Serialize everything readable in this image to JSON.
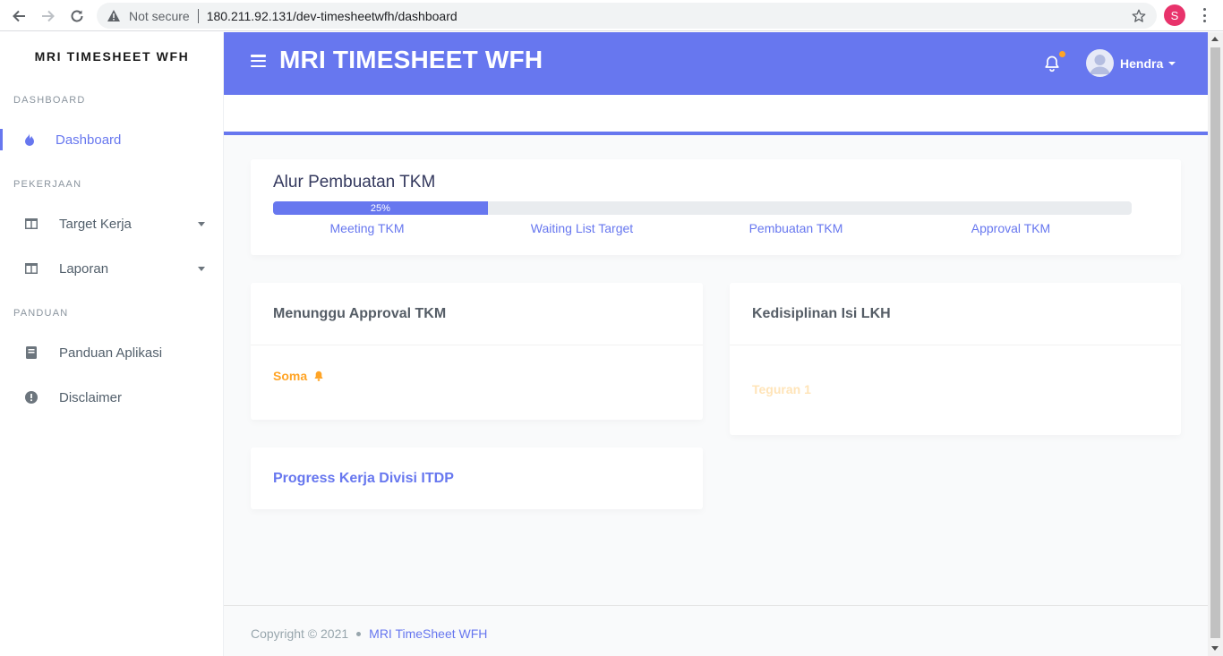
{
  "browser": {
    "security_label": "Not secure",
    "url": "180.211.92.131/dev-timesheetwfh/dashboard",
    "profile_initial": "S",
    "profile_color": "#e8336b"
  },
  "sidebar": {
    "brand": "MRI TIMESHEET WFH",
    "sections": [
      {
        "label": "DASHBOARD",
        "items": [
          {
            "label": "Dashboard",
            "icon": "fire-icon",
            "active": true
          }
        ]
      },
      {
        "label": "PEKERJAAN",
        "items": [
          {
            "label": "Target Kerja",
            "icon": "columns-icon",
            "dropdown": true
          },
          {
            "label": "Laporan",
            "icon": "columns-icon",
            "dropdown": true
          }
        ]
      },
      {
        "label": "PANDUAN",
        "items": [
          {
            "label": "Panduan Aplikasi",
            "icon": "book-icon"
          },
          {
            "label": "Disclaimer",
            "icon": "exclamation-circle-icon"
          }
        ]
      }
    ]
  },
  "header": {
    "title": "MRI TIMESHEET WFH",
    "user_name": "Hendra",
    "accent_color": "#6777ef"
  },
  "flow_card": {
    "title": "Alur Pembuatan TKM",
    "progress_label": "25%",
    "progress_value": 0.25,
    "steps": [
      "Meeting TKM",
      "Waiting List Target",
      "Pembuatan TKM",
      "Approval TKM"
    ]
  },
  "approval_card": {
    "title": "Menunggu Approval TKM",
    "item": "Soma"
  },
  "discipline_card": {
    "title": "Kedisiplinan Isi LKH",
    "item": "Teguran 1"
  },
  "progress_card": {
    "title": "Progress Kerja Divisi ITDP"
  },
  "footer": {
    "copyright": "Copyright © 2021",
    "brand": "MRI TimeSheet WFH"
  }
}
